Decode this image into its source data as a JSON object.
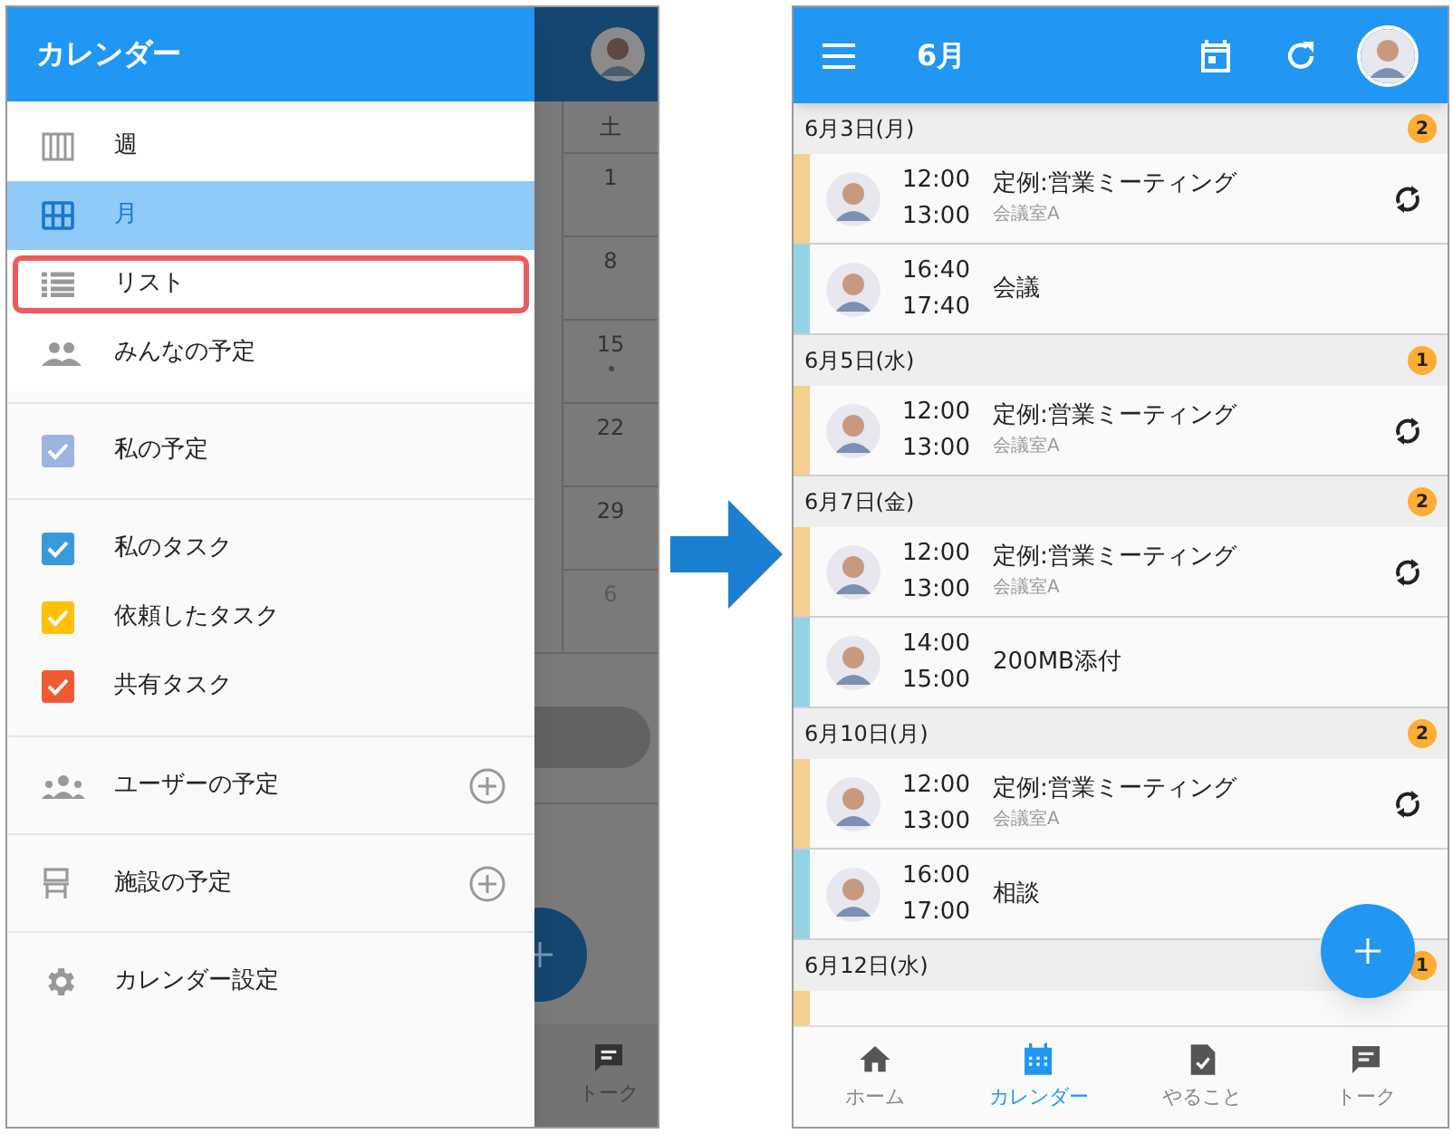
{
  "drawer": {
    "title": "カレンダー",
    "views": [
      {
        "label": "週",
        "selected": false,
        "highlighted": false
      },
      {
        "label": "月",
        "selected": true,
        "highlighted": false
      },
      {
        "label": "リスト",
        "selected": false,
        "highlighted": true
      },
      {
        "label": "みんなの予定",
        "selected": false,
        "highlighted": false
      }
    ],
    "my_calendar": {
      "label": "私の予定",
      "checked": true,
      "color": "#9db3e0"
    },
    "tasks": [
      {
        "label": "私のタスク",
        "checked": true,
        "color": "#3a9ad9"
      },
      {
        "label": "依頼したタスク",
        "checked": true,
        "color": "#ffc107"
      },
      {
        "label": "共有タスク",
        "checked": true,
        "color": "#ef5a33"
      }
    ],
    "groups": [
      {
        "label": "ユーザーの予定"
      },
      {
        "label": "施設の予定"
      }
    ],
    "settings": "カレンダー設定"
  },
  "behind": {
    "weekday": "土",
    "dates": [
      {
        "day": "1",
        "dot": false,
        "muted": false
      },
      {
        "day": "8",
        "dot": false,
        "muted": false
      },
      {
        "day": "15",
        "dot": true,
        "muted": false
      },
      {
        "day": "22",
        "dot": false,
        "muted": false
      },
      {
        "day": "29",
        "dot": false,
        "muted": false
      },
      {
        "day": "6",
        "dot": false,
        "muted": true
      }
    ],
    "nav_label": "トーク"
  },
  "list_screen": {
    "title": "6月",
    "days": [
      {
        "date": "6月3日(月)",
        "count": "2",
        "events": [
          {
            "start": "12:00",
            "end": "13:00",
            "title": "定例:営業ミーティング",
            "location": "会議室A",
            "recurring": true,
            "color": "#f5cf8e"
          },
          {
            "start": "16:40",
            "end": "17:40",
            "title": "会議",
            "recurring": false,
            "color": "#93d3e3"
          }
        ]
      },
      {
        "date": "6月5日(水)",
        "count": "1",
        "events": [
          {
            "start": "12:00",
            "end": "13:00",
            "title": "定例:営業ミーティング",
            "location": "会議室A",
            "recurring": true,
            "color": "#f5cf8e"
          }
        ]
      },
      {
        "date": "6月7日(金)",
        "count": "2",
        "events": [
          {
            "start": "12:00",
            "end": "13:00",
            "title": "定例:営業ミーティング",
            "location": "会議室A",
            "recurring": true,
            "color": "#f5cf8e"
          },
          {
            "start": "14:00",
            "end": "15:00",
            "title": "200MB添付",
            "recurring": false,
            "color": "#93d3e3"
          }
        ]
      },
      {
        "date": "6月10日(月)",
        "count": "2",
        "events": [
          {
            "start": "12:00",
            "end": "13:00",
            "title": "定例:営業ミーティング",
            "location": "会議室A",
            "recurring": true,
            "color": "#f5cf8e"
          },
          {
            "start": "16:00",
            "end": "17:00",
            "title": "相談",
            "recurring": false,
            "color": "#93d3e3"
          }
        ]
      },
      {
        "date": "6月12日(水)",
        "count": "1",
        "events": [
          {
            "kind": "cut",
            "color": "#f5cf8e"
          }
        ]
      }
    ],
    "nav": [
      {
        "label": "ホーム",
        "selected": false
      },
      {
        "label": "カレンダー",
        "selected": true
      },
      {
        "label": "やること",
        "selected": false
      },
      {
        "label": "トーク",
        "selected": false
      }
    ]
  }
}
